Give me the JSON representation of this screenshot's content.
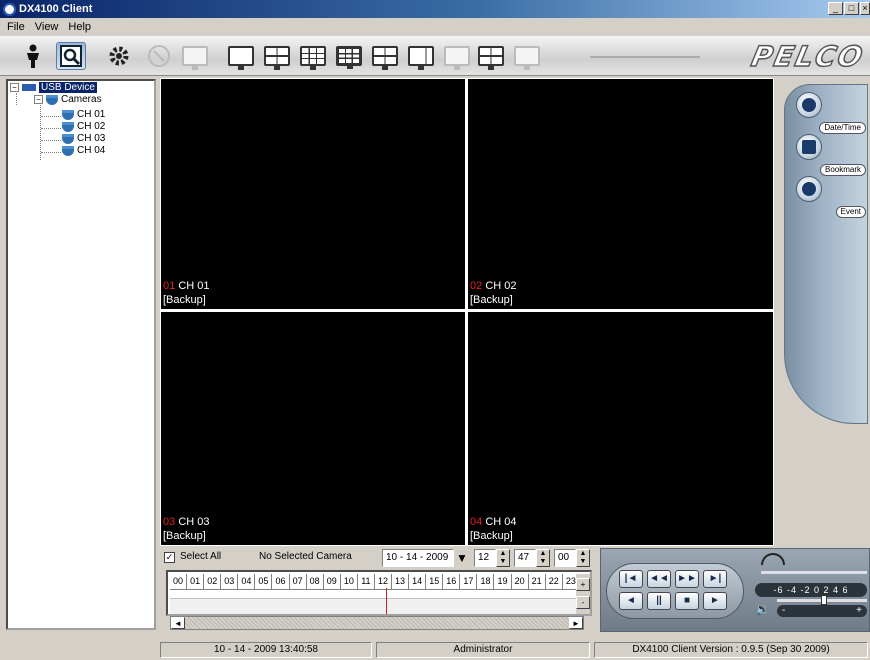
{
  "window": {
    "title": "DX4100 Client"
  },
  "menu": [
    "File",
    "View",
    "Help"
  ],
  "brand": "PELCO",
  "tree": {
    "device": "USB Device",
    "group": "Cameras",
    "channels": [
      "CH 01",
      "CH 02",
      "CH 03",
      "CH 04"
    ]
  },
  "cells": [
    {
      "num": "01",
      "name": "CH 01",
      "status": "[Backup]"
    },
    {
      "num": "02",
      "name": "CH 02",
      "status": "[Backup]"
    },
    {
      "num": "03",
      "name": "CH 03",
      "status": "[Backup]"
    },
    {
      "num": "04",
      "name": "CH 04",
      "status": "[Backup]"
    }
  ],
  "side": {
    "datetime": "Date/Time",
    "bookmark": "Bookmark",
    "event": "Event"
  },
  "search": {
    "select_all": "Select All",
    "camera": "No Selected Camera",
    "date": "10 - 14 - 2009",
    "hour": "12",
    "minute": "47",
    "second": "00"
  },
  "timeline": {
    "hours": [
      "00",
      "01",
      "02",
      "03",
      "04",
      "05",
      "06",
      "07",
      "08",
      "09",
      "10",
      "11",
      "12",
      "13",
      "14",
      "15",
      "16",
      "17",
      "18",
      "19",
      "20",
      "21",
      "22",
      "23"
    ]
  },
  "playback": {
    "speed_scale": "-6 -4 -2 0 2 4 6",
    "vol_minus": "-",
    "vol_plus": "+"
  },
  "status": {
    "datetime": "10 - 14 - 2009  13:40:58",
    "user": "Administrator",
    "version": "DX4100 Client Version : 0.9.5 (Sep 30 2009)"
  },
  "colors": {
    "accent": "#0a246a",
    "channel_num": "#e02020"
  }
}
